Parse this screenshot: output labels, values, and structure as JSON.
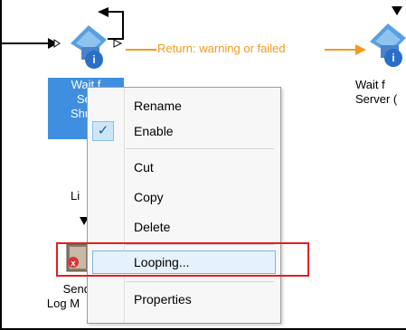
{
  "workflow": {
    "activities": {
      "wait_selected": {
        "lines": [
          "Wait f",
          "Ser",
          "Shutd"
        ]
      },
      "wait_right": {
        "lines": [
          "Wait f",
          "Server ("
        ]
      },
      "send_log": {
        "lines": [
          "Send",
          "Log M"
        ]
      },
      "link_partial": "Li"
    },
    "link_label": "Return: warning or failed",
    "colors": {
      "link": "#f39a1a",
      "selection": "#3f8fe0",
      "highlight_box": "#e02020"
    }
  },
  "context_menu": {
    "items": [
      {
        "label": "Rename"
      },
      {
        "label": "Enable",
        "checked": true,
        "check_glyph": "✓"
      },
      {
        "label": "Cut"
      },
      {
        "label": "Copy"
      },
      {
        "label": "Delete"
      },
      {
        "label": "Looping...",
        "highlighted": true
      },
      {
        "label": "Properties"
      }
    ]
  }
}
